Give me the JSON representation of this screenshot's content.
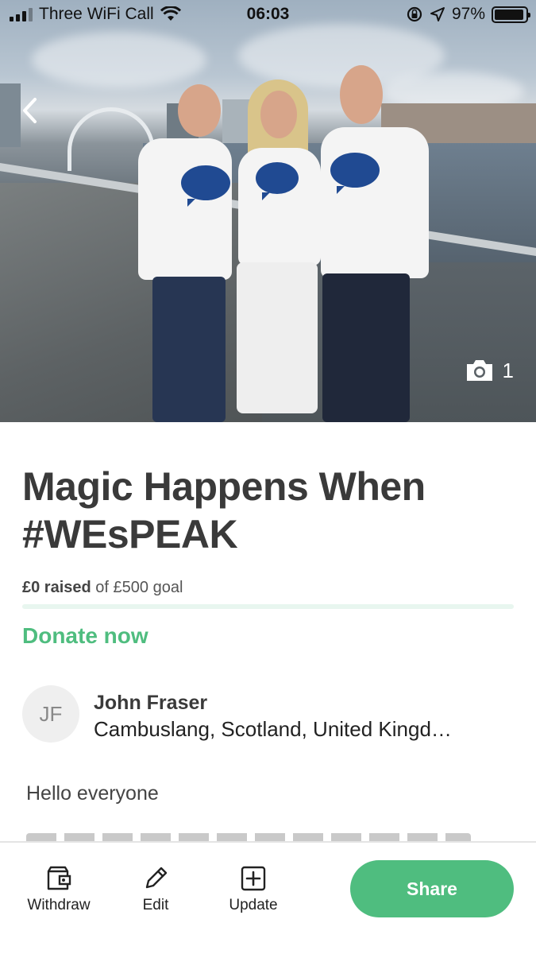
{
  "status_bar": {
    "carrier": "Three WiFi Call",
    "time": "06:03",
    "battery_percent": "97%"
  },
  "hero": {
    "photo_count": "1"
  },
  "campaign": {
    "title": "Magic Happens When #WEsPEAK",
    "raised_amount": "£0 raised",
    "goal_text": "of £500 goal",
    "progress_fraction": 0,
    "donate_label": "Donate now"
  },
  "organizer": {
    "initials": "JF",
    "name": "John Fraser",
    "location": "Cambuslang, Scotland, United Kingd…"
  },
  "story": {
    "first_line": "Hello everyone"
  },
  "bottom_bar": {
    "withdraw_label": "Withdraw",
    "edit_label": "Edit",
    "update_label": "Update",
    "share_label": "Share"
  },
  "colors": {
    "accent_green": "#4fbd7f",
    "progress_track": "#e8f6ef",
    "text_dark": "#3a3a3a"
  }
}
